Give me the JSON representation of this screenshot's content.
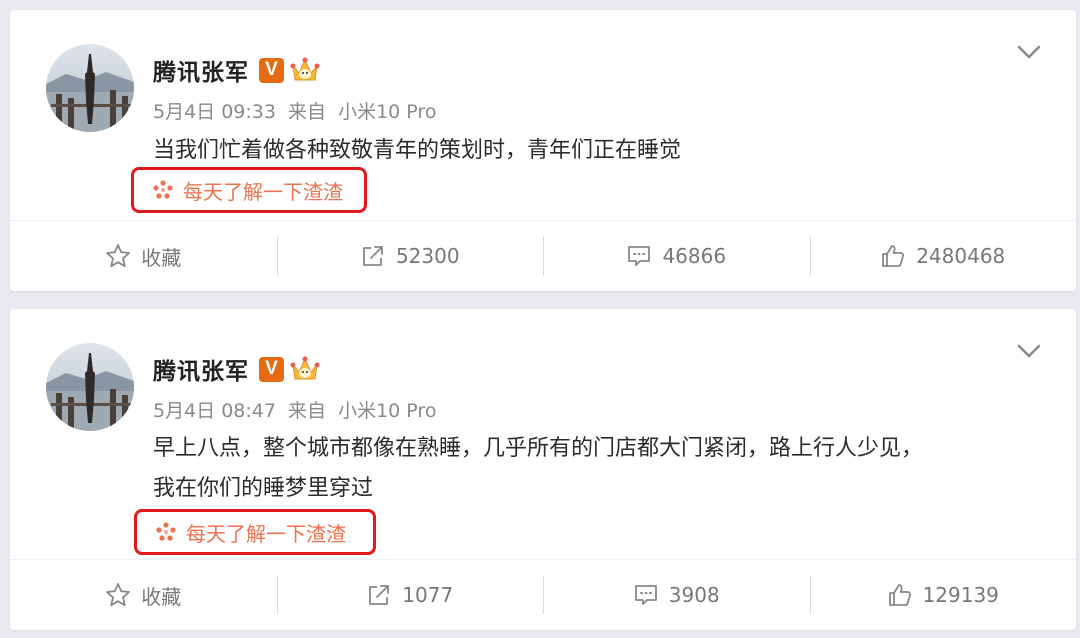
{
  "colors": {
    "background": "#e9e9ee",
    "card": "#ffffff",
    "name": "#222222",
    "meta": "#8a8a8a",
    "body_text": "#2c2c2c",
    "topic": "#eb7350",
    "highlight_box": "#e0191f",
    "verified_badge": "#e66b10"
  },
  "posts": [
    {
      "author": "腾讯张军",
      "badge": "V",
      "date": "5月4日 09:33",
      "source_prefix": "来自",
      "source": "小米10 Pro",
      "text_lines": [
        "当我们忙着做各种致敬青年的策划时，青年们正在睡觉"
      ],
      "topic": "每天了解一下渣渣",
      "actions": {
        "favorite_label": "收藏",
        "repost_count": "52300",
        "comment_count": "46866",
        "like_count": "2480468"
      }
    },
    {
      "author": "腾讯张军",
      "badge": "V",
      "date": "5月4日 08:47",
      "source_prefix": "来自",
      "source": "小米10 Pro",
      "text_lines": [
        "早上八点，整个城市都像在熟睡，几乎所有的门店都大门紧闭，路上行人少见，",
        "我在你们的睡梦里穿过"
      ],
      "topic": "每天了解一下渣渣",
      "actions": {
        "favorite_label": "收藏",
        "repost_count": "1077",
        "comment_count": "3908",
        "like_count": "129139"
      }
    }
  ],
  "icons": {
    "avatar": "avatar-photo",
    "verified": "verified-v-badge",
    "member": "crown-member-icon",
    "menu": "chevron-down-icon",
    "topic": "topic-flower-icon",
    "favorite": "star-icon",
    "repost": "share-arrow-icon",
    "comment": "comment-bubble-icon",
    "like": "thumbs-up-icon"
  }
}
